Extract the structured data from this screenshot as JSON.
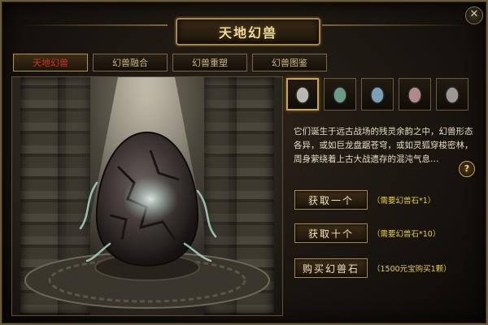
{
  "window": {
    "title": "天地幻兽",
    "close_icon": "✕"
  },
  "tabs": [
    {
      "label": "天地幻兽",
      "active": true
    },
    {
      "label": "幻兽融合",
      "active": false
    },
    {
      "label": "幻兽重塑",
      "active": false
    },
    {
      "label": "幻兽图鉴",
      "active": false
    }
  ],
  "egg_slots": [
    {
      "icon": "egg-icon",
      "color": "#b8b8b0",
      "selected": true
    },
    {
      "icon": "egg-icon",
      "color": "#6a9a8a",
      "selected": false
    },
    {
      "icon": "egg-icon",
      "color": "#7aa0b8",
      "selected": false
    },
    {
      "icon": "egg-icon",
      "color": "#b08a8a",
      "selected": false
    },
    {
      "icon": "egg-icon",
      "color": "#9a9a92",
      "selected": false
    }
  ],
  "description": "它们诞生于远古战场的残灵余韵之中，幻兽形态各异，或如巨龙盘踞苍穹，或如灵狐穿梭密林，周身萦绕着上古大战遗存的混沌气息…",
  "help_label": "?",
  "actions": [
    {
      "label": "获取一个",
      "note": "（需要幻兽石*1）"
    },
    {
      "label": "获取十个",
      "note": "（需要幻兽石*10）"
    },
    {
      "label": "购买幻兽石",
      "note": "（1500元宝购买1颗）"
    }
  ],
  "colors": {
    "accent_gold": "#c9a55a",
    "active_tab_text": "#d3301e",
    "note_text": "#e9cf42"
  }
}
